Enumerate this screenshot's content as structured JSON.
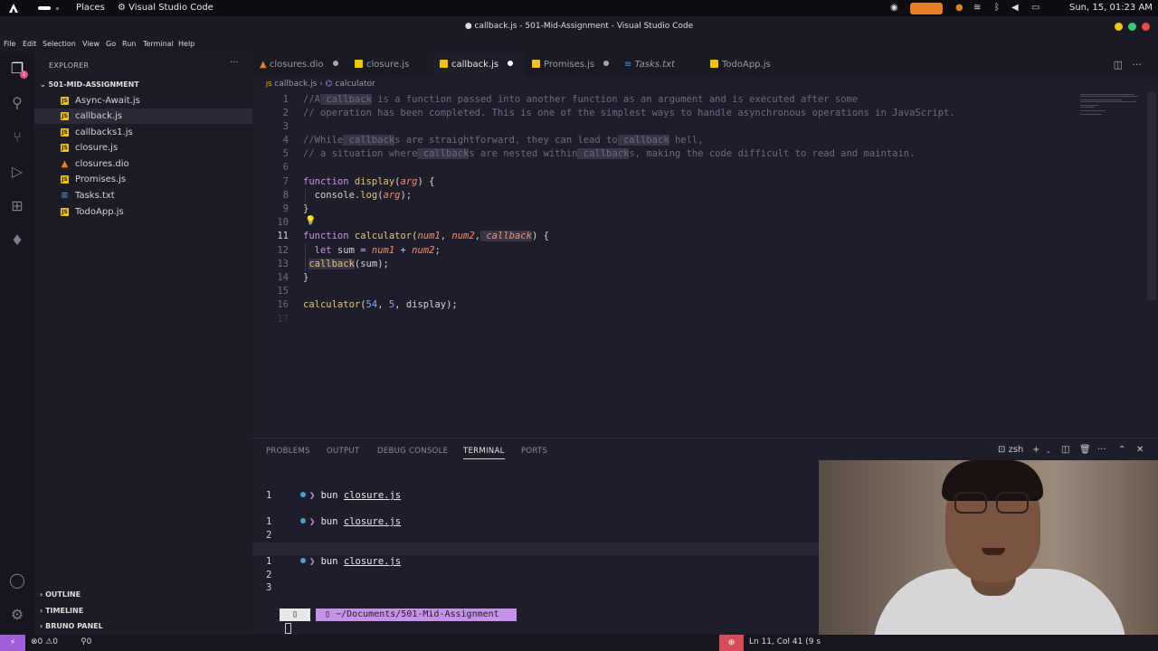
{
  "system_bar": {
    "places": "Places",
    "app_name": "Visual Studio Code",
    "clock": "Sun, 15, 01:23 AM"
  },
  "window": {
    "title": "● callback.js - 501-Mid-Assignment - Visual Studio Code"
  },
  "menu": [
    "File",
    "Edit",
    "Selection",
    "View",
    "Go",
    "Run",
    "Terminal",
    "Help"
  ],
  "activity_bar": {
    "explorer_badge": "1"
  },
  "explorer": {
    "title": "EXPLORER",
    "more": "···",
    "folder": "501-MID-ASSIGNMENT",
    "files": [
      {
        "name": "Async-Await.js",
        "type": "js"
      },
      {
        "name": "callback.js",
        "type": "js",
        "selected": true
      },
      {
        "name": "callbacks1.js",
        "type": "js"
      },
      {
        "name": "closure.js",
        "type": "js"
      },
      {
        "name": "closures.dio",
        "type": "dio"
      },
      {
        "name": "Promises.js",
        "type": "js"
      },
      {
        "name": "Tasks.txt",
        "type": "txt"
      },
      {
        "name": "TodoApp.js",
        "type": "js"
      }
    ],
    "sections": [
      "OUTLINE",
      "TIMELINE",
      "BRUNO PANEL"
    ]
  },
  "tabs": [
    {
      "label": "closures.dio",
      "modified": true
    },
    {
      "label": "closure.js",
      "modified": false
    },
    {
      "label": "callback.js",
      "modified": true,
      "active": true
    },
    {
      "label": "Promises.js",
      "modified": true
    },
    {
      "label": "Tasks.txt",
      "modified": false
    },
    {
      "label": "TodoApp.js",
      "modified": false
    }
  ],
  "breadcrumb": {
    "file": "callback.js",
    "symbol": "calculator"
  },
  "editor": {
    "line_numbers": [
      "1",
      "2",
      "3",
      "4",
      "5",
      "6",
      "7",
      "8",
      "9",
      "10",
      "11",
      "12",
      "13",
      "14",
      "15",
      "16",
      "17"
    ],
    "current_line": "11"
  },
  "panel": {
    "tabs": [
      "PROBLEMS",
      "OUTPUT",
      "DEBUG CONSOLE",
      "TERMINAL",
      "PORTS"
    ],
    "active_tab": "TERMINAL",
    "shell": "zsh",
    "terminal": {
      "command_prompt": "❯",
      "command": "bun",
      "file": "closure.js",
      "path": "~/Documents/501-Mid-Assignment",
      "path_bold": "501-Mid-Assignment",
      "outputs": [
        [
          "1"
        ],
        [
          "1",
          "2"
        ],
        [
          "1",
          "2",
          "3"
        ]
      ]
    }
  },
  "status": {
    "remote": "⚡",
    "errors": "0",
    "warnings": "0",
    "ports": "0",
    "position": "Ln 11, Col 41 (9 s"
  }
}
